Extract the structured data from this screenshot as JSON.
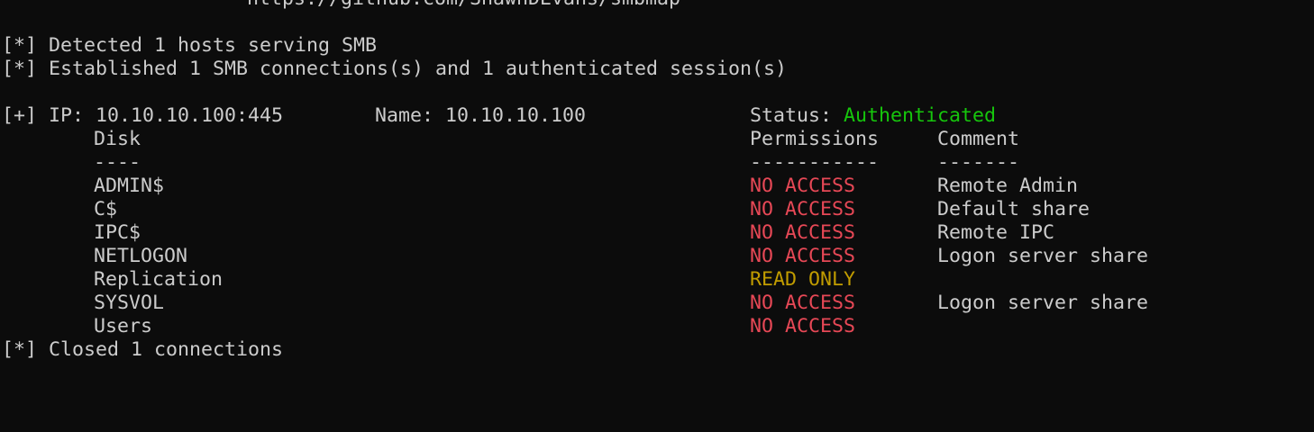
{
  "terminal": {
    "url_fragment": "https://github.com/ShawnDEvans/smbmap",
    "detected_line": "[*] Detected 1 hosts serving SMB",
    "established_line": "[*] Established 1 SMB connections(s) and 1 authenticated session(s)",
    "host": {
      "prefix": "[+]",
      "ip_label": "IP: 10.10.10.100:445",
      "name_label": "Name: 10.10.10.100",
      "status_label": "Status:",
      "status_value": "Authenticated"
    },
    "headers": {
      "disk": "Disk",
      "permissions": "Permissions",
      "comment": "Comment"
    },
    "separators": {
      "disk": "----",
      "permissions": "-----------",
      "comment": "-------"
    },
    "shares": [
      {
        "disk": "ADMIN$",
        "permissions": "NO ACCESS",
        "comment": "Remote Admin"
      },
      {
        "disk": "C$",
        "permissions": "NO ACCESS",
        "comment": "Default share"
      },
      {
        "disk": "IPC$",
        "permissions": "NO ACCESS",
        "comment": "Remote IPC"
      },
      {
        "disk": "NETLOGON",
        "permissions": "NO ACCESS",
        "comment": "Logon server share"
      },
      {
        "disk": "Replication",
        "permissions": "READ ONLY",
        "comment": ""
      },
      {
        "disk": "SYSVOL",
        "permissions": "NO ACCESS",
        "comment": "Logon server share"
      },
      {
        "disk": "Users",
        "permissions": "NO ACCESS",
        "comment": ""
      }
    ],
    "closed_line": "[*] Closed 1 connections"
  },
  "colors": {
    "background": "#0c0c0c",
    "text": "#cccccc",
    "authenticated": "#16c60c",
    "no_access": "#e74856",
    "read_only": "#c19c00"
  }
}
